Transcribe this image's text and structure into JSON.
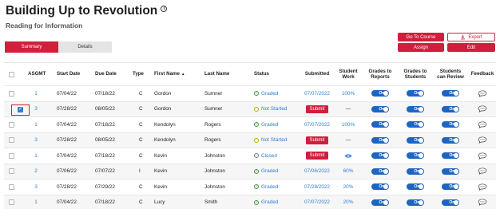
{
  "page": {
    "title": "Building Up to Revolution",
    "info_icon": "i",
    "subtitle": "Reading for Information"
  },
  "tabs": [
    {
      "label": "Summary",
      "active": true
    },
    {
      "label": "Details",
      "active": false
    }
  ],
  "actions": {
    "go_to_course": "Go To Course",
    "export": "Export",
    "assign": "Assign",
    "edit": "Edit"
  },
  "icons": {
    "sort": "sort-asc-icon",
    "export": "download-icon",
    "feedback": "speech-bubble-icon",
    "eye": "eye-icon",
    "graded": "check-circle-icon",
    "not_started": "circle-icon",
    "closed": "minus-circle-icon"
  },
  "colors": {
    "accent_red": "#cf1f3d",
    "link_blue": "#2f7fd1",
    "toggle_blue": "#1f64c0",
    "highlight": "#e01a1a"
  },
  "table": {
    "headers": {
      "asgmt": "ASGMT",
      "start": "Start Date",
      "due": "Due Date",
      "type": "Type",
      "first": "First Name",
      "sort_arrow": "▲",
      "last": "Last Name",
      "status": "Status",
      "submitted": "Submitted",
      "work_1": "Student",
      "work_2": "Work",
      "gr_1": "Grades to",
      "gr_2": "Reports",
      "gs_1": "Grades to",
      "gs_2": "Students",
      "cr_1": "Students",
      "cr_2": "can Review",
      "feedback": "Feedback"
    },
    "check_mark": "✓",
    "toggle_label": "On",
    "rows": [
      {
        "asgmt": "1",
        "start": "07/04/22",
        "due": "07/18/22",
        "type": "C",
        "first": "Gordon",
        "last": "Sumner",
        "status": "Graded",
        "submitted": "07/07/2022",
        "work": "100%",
        "checked": false
      },
      {
        "asgmt": "3",
        "start": "07/28/22",
        "due": "08/05/22",
        "type": "C",
        "first": "Gordon",
        "last": "Sumner",
        "status": "Not Started",
        "submitted": "Submit",
        "work": "—",
        "checked": true
      },
      {
        "asgmt": "1",
        "start": "07/04/22",
        "due": "07/18/22",
        "type": "C",
        "first": "Kendolyn",
        "last": "Rogers",
        "status": "Graded",
        "submitted": "07/07/2022",
        "work": "100%",
        "checked": false
      },
      {
        "asgmt": "3",
        "start": "07/28/22",
        "due": "08/05/22",
        "type": "C",
        "first": "Kendolyn",
        "last": "Rogers",
        "status": "Not Started",
        "submitted": "Submit",
        "work": "—",
        "checked": false
      },
      {
        "asgmt": "1",
        "start": "07/04/22",
        "due": "07/18/22",
        "type": "C",
        "first": "Kevin",
        "last": "Johnston",
        "status": "Closed",
        "submitted": "Submit",
        "work": "eye",
        "checked": false
      },
      {
        "asgmt": "2",
        "start": "07/06/22",
        "due": "07/07/22",
        "type": "I",
        "first": "Kevin",
        "last": "Johnston",
        "status": "Graded",
        "submitted": "07/06/2022",
        "work": "60%",
        "checked": false
      },
      {
        "asgmt": "3",
        "start": "07/28/22",
        "due": "07/29/22",
        "type": "C",
        "first": "Kevin",
        "last": "Johnston",
        "status": "Graded",
        "submitted": "07/28/2022",
        "work": "20%",
        "checked": false
      },
      {
        "asgmt": "1",
        "start": "07/04/22",
        "due": "07/18/22",
        "type": "C",
        "first": "Lucy",
        "last": "Smith",
        "status": "Graded",
        "submitted": "07/07/2022",
        "work": "20%",
        "checked": false
      }
    ]
  }
}
